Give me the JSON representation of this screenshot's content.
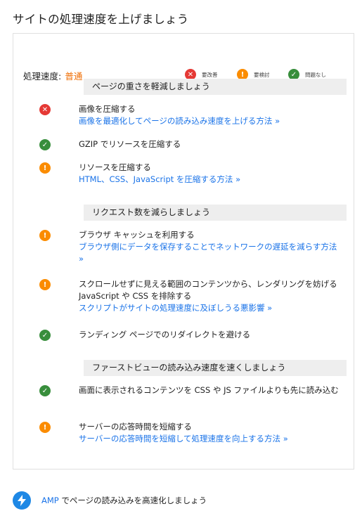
{
  "page_title": "サイトの処理速度を上げましょう",
  "speed": {
    "label": "処理速度:",
    "value": "普通"
  },
  "legend": [
    {
      "icon": "error-icon",
      "glyph": "✕",
      "label": "要改善",
      "color": "#e53935"
    },
    {
      "icon": "warning-icon",
      "glyph": "!",
      "label": "要検討",
      "color": "#fb8c00"
    },
    {
      "icon": "check-icon",
      "glyph": "✓",
      "label": "問題なし",
      "color": "#388e3c"
    }
  ],
  "sections": [
    {
      "header": "ページの重さを軽減しましょう",
      "items": [
        {
          "status": "error",
          "glyph": "✕",
          "title": "画像を圧縮する",
          "link": "画像を最適化してページの読み込み速度を上げる方法 »"
        },
        {
          "status": "ok",
          "glyph": "✓",
          "title": "GZIP でリソースを圧縮する",
          "link": ""
        },
        {
          "status": "warning",
          "glyph": "!",
          "title": "リソースを圧縮する",
          "link": "HTML、CSS、JavaScript を圧縮する方法 »"
        }
      ]
    },
    {
      "header": "リクエスト数を減らしましょう",
      "items": [
        {
          "status": "warning",
          "glyph": "!",
          "title": "ブラウザ キャッシュを利用する",
          "link": "ブラウザ側にデータを保存することでネットワークの遅延を減らす方法 »"
        },
        {
          "status": "warning",
          "glyph": "!",
          "title": "スクロールせずに見える範囲のコンテンツから、レンダリングを妨げる JavaScript や CSS を排除する",
          "link": "スクリプトがサイトの処理速度に及ぼしうる悪影響 »"
        },
        {
          "status": "ok",
          "glyph": "✓",
          "title": "ランディング ページでのリダイレクトを避ける",
          "link": ""
        }
      ]
    },
    {
      "header": "ファーストビューの読み込み速度を速くしましょう",
      "items": [
        {
          "status": "ok",
          "glyph": "✓",
          "title": "画面に表示されるコンテンツを CSS や JS ファイルよりも先に読み込む",
          "link": ""
        },
        {
          "status": "warning",
          "glyph": "!",
          "title": "サーバーの応答時間を短縮する",
          "link": "サーバーの応答時間を短縮して処理速度を向上する方法 »"
        }
      ]
    }
  ],
  "amp": {
    "link": "AMP",
    "text": " でページの読み込みを高速化しましょう",
    "icon": "lightning-icon"
  }
}
